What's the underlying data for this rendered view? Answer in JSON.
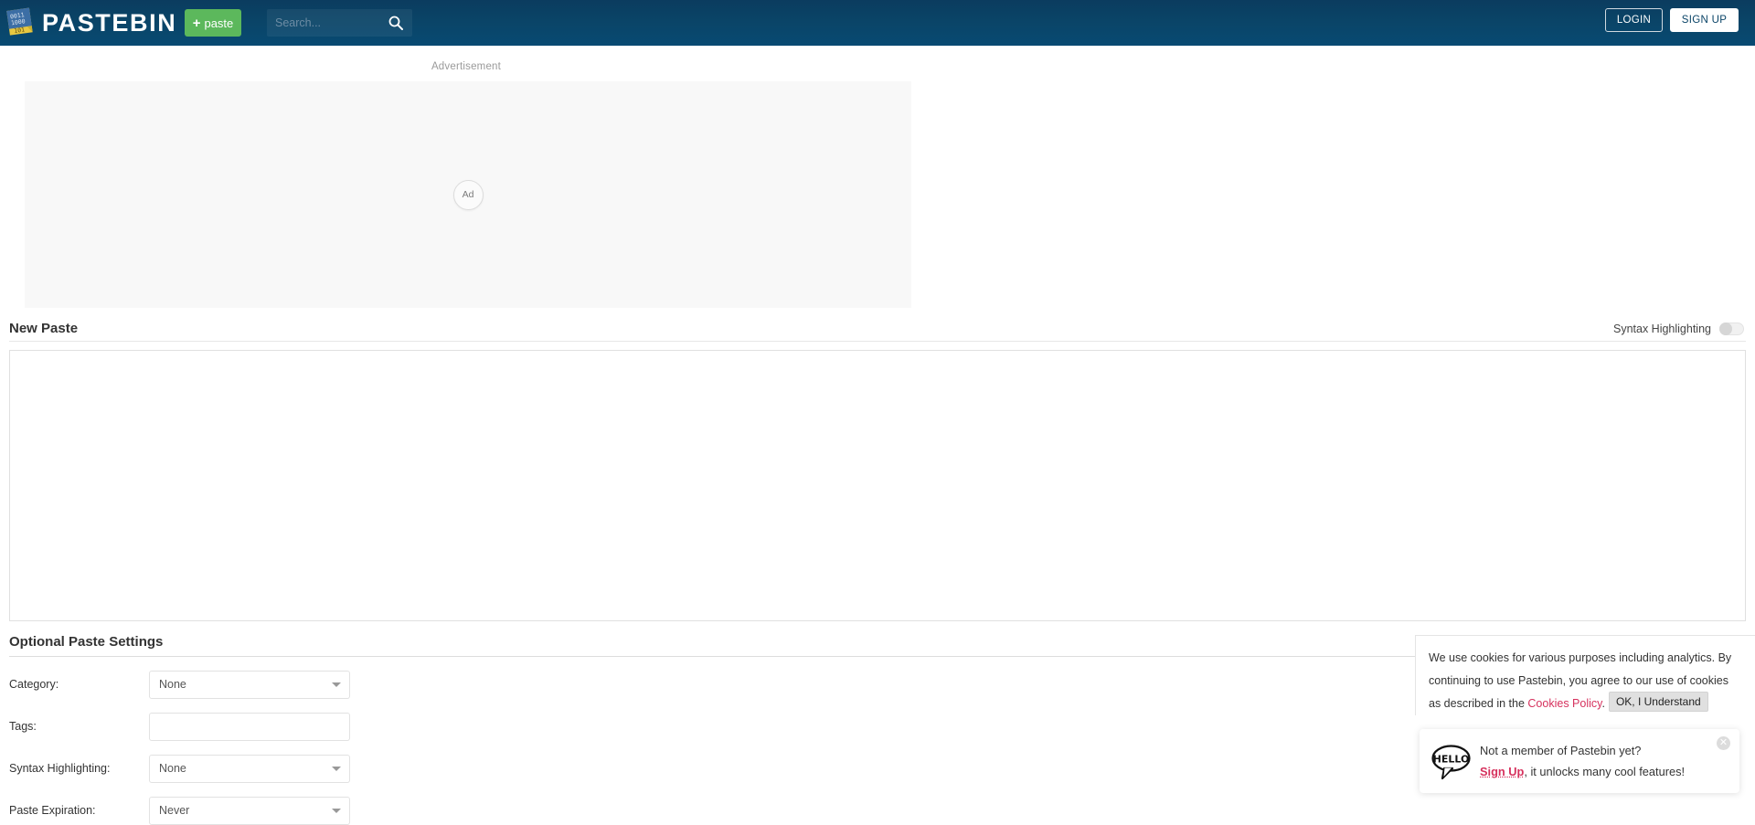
{
  "header": {
    "brand": "PASTEBIN",
    "logo_icon": "pastebin-logo-icon",
    "paste_button": {
      "label": "paste",
      "plus": "+",
      "color": "#5cb85c"
    },
    "search": {
      "placeholder": "Search...",
      "value": "",
      "icon": "search-icon"
    },
    "login_label": "LOGIN",
    "signup_label": "SIGN UP",
    "background_color": "#0a4467"
  },
  "advertisement": {
    "label": "Advertisement",
    "badge": "Ad"
  },
  "new_paste": {
    "title": "New Paste",
    "syntax_highlighting_label": "Syntax Highlighting",
    "syntax_highlighting_enabled": "off",
    "textarea_value": "",
    "textarea_placeholder": ""
  },
  "optional_settings": {
    "title": "Optional Paste Settings",
    "rows": [
      {
        "label": "Category:",
        "type": "select",
        "value": "None"
      },
      {
        "label": "Tags:",
        "type": "text",
        "value": "",
        "placeholder": ""
      },
      {
        "label": "Syntax Highlighting:",
        "type": "select",
        "value": "None"
      },
      {
        "label": "Paste Expiration:",
        "type": "select",
        "value": "Never"
      }
    ]
  },
  "cookie_banner": {
    "line1": "We use cookies for various purposes including analytics. By",
    "line2": "continuing to use Pastebin, you agree to our use of cookies",
    "line3_prefix": "as described in the ",
    "policy_link": "Cookies Policy",
    "line3_suffix": ".",
    "ok_label": "OK, I Understand",
    "link_color": "#d6315d"
  },
  "hello_popup": {
    "badge_text": "HELLO",
    "line1": "Not a member of Pastebin yet?",
    "signup_link": "Sign Up",
    "line2_suffix": ", it unlocks many cool features!",
    "close_icon": "close-icon",
    "link_color": "#d6315d"
  }
}
